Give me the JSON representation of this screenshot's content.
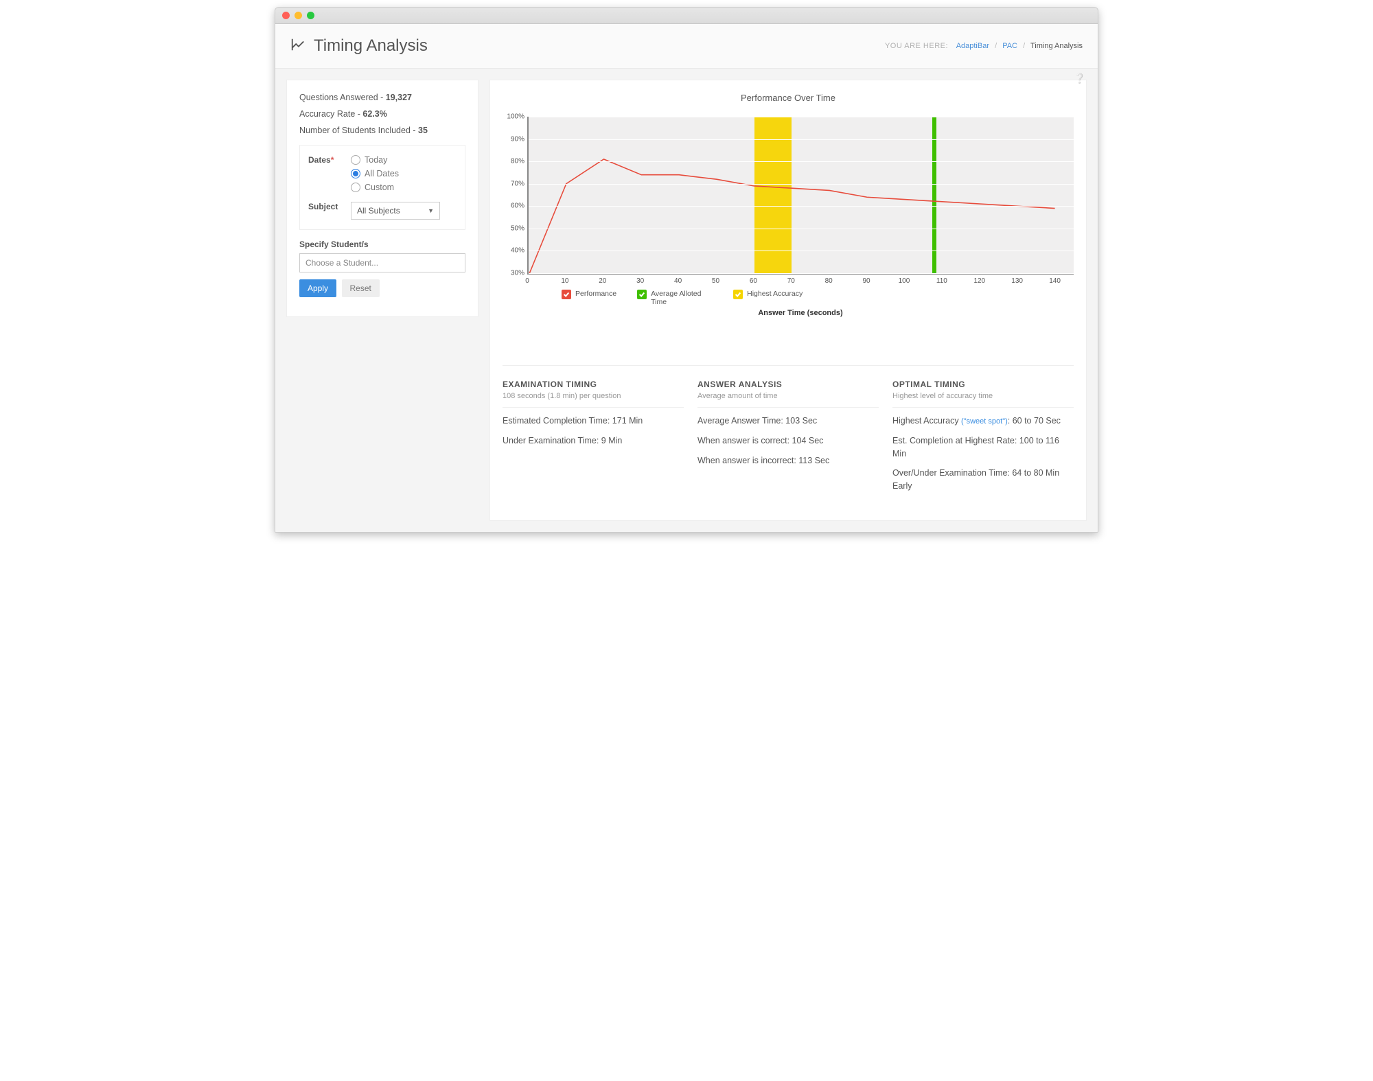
{
  "header": {
    "title": "Timing Analysis",
    "breadcrumb_label": "YOU ARE HERE:",
    "breadcrumb": [
      {
        "text": "AdaptiBar",
        "link": true
      },
      {
        "text": "PAC",
        "link": true
      },
      {
        "text": "Timing Analysis",
        "link": false
      }
    ]
  },
  "sidebar": {
    "stats": {
      "questions_label": "Questions Answered - ",
      "questions_value": "19,327",
      "accuracy_label": "Accuracy Rate - ",
      "accuracy_value": "62.3%",
      "students_label": "Number of Students Included - ",
      "students_value": "35"
    },
    "dates_label": "Dates",
    "date_options": {
      "today": "Today",
      "all": "All Dates",
      "custom": "Custom"
    },
    "date_selected": "all",
    "subject_label": "Subject",
    "subject_value": "All Subjects",
    "specify_label": "Specify Student/s",
    "specify_placeholder": "Choose a Student...",
    "apply_label": "Apply",
    "reset_label": "Reset"
  },
  "chart_data": {
    "type": "line",
    "title": "Performance Over Time",
    "xlabel": "Answer Time (seconds)",
    "ylabel": "",
    "x": [
      0,
      10,
      20,
      30,
      40,
      50,
      60,
      70,
      80,
      90,
      100,
      110,
      120,
      130,
      140
    ],
    "series": [
      {
        "name": "Performance",
        "color": "#e74c3c",
        "values": [
          29,
          70,
          81,
          74,
          74,
          72,
          69,
          68,
          67,
          64,
          63,
          62,
          61,
          60,
          59
        ]
      }
    ],
    "ylim": [
      30,
      100
    ],
    "xlim": [
      0,
      145
    ],
    "y_ticks": [
      30,
      40,
      50,
      60,
      70,
      80,
      90,
      100
    ],
    "x_ticks": [
      0,
      10,
      20,
      30,
      40,
      50,
      60,
      70,
      80,
      90,
      100,
      110,
      120,
      130,
      140
    ],
    "bands": [
      {
        "name": "Highest Accuracy",
        "color": "#f5d400",
        "from": 60,
        "to": 70
      },
      {
        "name": "Average Allotted Time",
        "color": "#3fbf00",
        "at": 108
      }
    ],
    "legend": [
      {
        "label": "Performance",
        "color": "red"
      },
      {
        "label": "Average Alloted Time",
        "color": "green"
      },
      {
        "label": "Highest Accuracy",
        "color": "yellow"
      }
    ]
  },
  "summary": {
    "exam": {
      "heading": "EXAMINATION TIMING",
      "sub": "108 seconds (1.8 min) per question",
      "lines": [
        "Estimated Completion Time: 171 Min",
        "Under Examination Time: 9 Min"
      ]
    },
    "answer": {
      "heading": "ANSWER ANALYSIS",
      "sub": "Average amount of time",
      "lines": [
        "Average Answer Time: 103 Sec",
        "When answer is correct: 104 Sec",
        "When answer is incorrect: 113 Sec"
      ]
    },
    "optimal": {
      "heading": "OPTIMAL TIMING",
      "sub": "Highest level of accuracy time",
      "sweet_prefix": "Highest Accuracy ",
      "sweet_label": "(\"sweet spot\")",
      "sweet_value": ": 60 to 70 Sec",
      "lines": [
        "Est. Completion at Highest Rate: 100 to 116 Min",
        "Over/Under Examination Time: 64 to 80 Min Early"
      ]
    }
  }
}
